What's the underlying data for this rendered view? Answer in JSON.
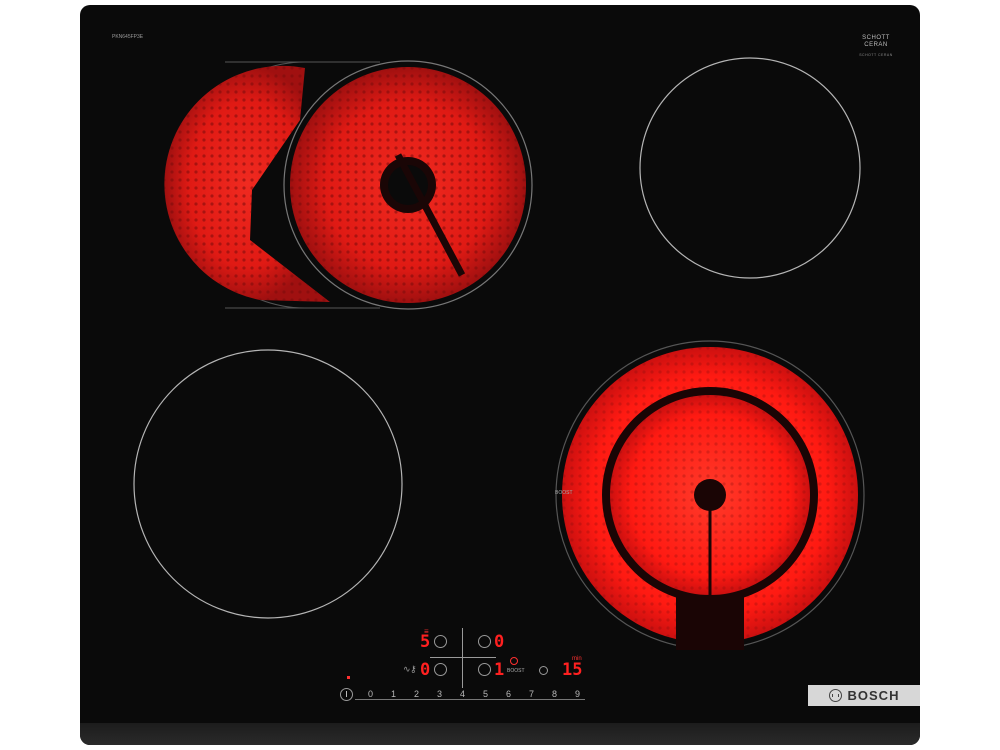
{
  "brand": {
    "name": "BOSCH"
  },
  "glass_brand": {
    "line1": "SCHOTT",
    "line2": "CERAN",
    "sub": "SCHOTT CERAN"
  },
  "model_label": "PKN645FP3E",
  "zones": [
    {
      "id": "front-left-dual-oval",
      "state": "on",
      "color": "#e8201a"
    },
    {
      "id": "rear-right",
      "state": "off"
    },
    {
      "id": "front-left",
      "state": "off"
    },
    {
      "id": "front-right-dual",
      "state": "on",
      "color": "#ff2222"
    }
  ],
  "zone_labels": {
    "boost": "BOOST"
  },
  "controls": {
    "row1_left_digit": "5",
    "row1_right_digit": "0",
    "row2_left_digit": "0",
    "row2_right_digit": "1",
    "boost_label": "BOOST",
    "timer_label": "min",
    "timer_value": "15",
    "slider_values": [
      "0",
      "1",
      "2",
      "3",
      "4",
      "5",
      "6",
      "7",
      "8",
      "9"
    ],
    "slider_separator": "·"
  },
  "colors": {
    "glass": "#0a0a0a",
    "glow": "#ff2020",
    "outline": "#9a9a9a"
  }
}
